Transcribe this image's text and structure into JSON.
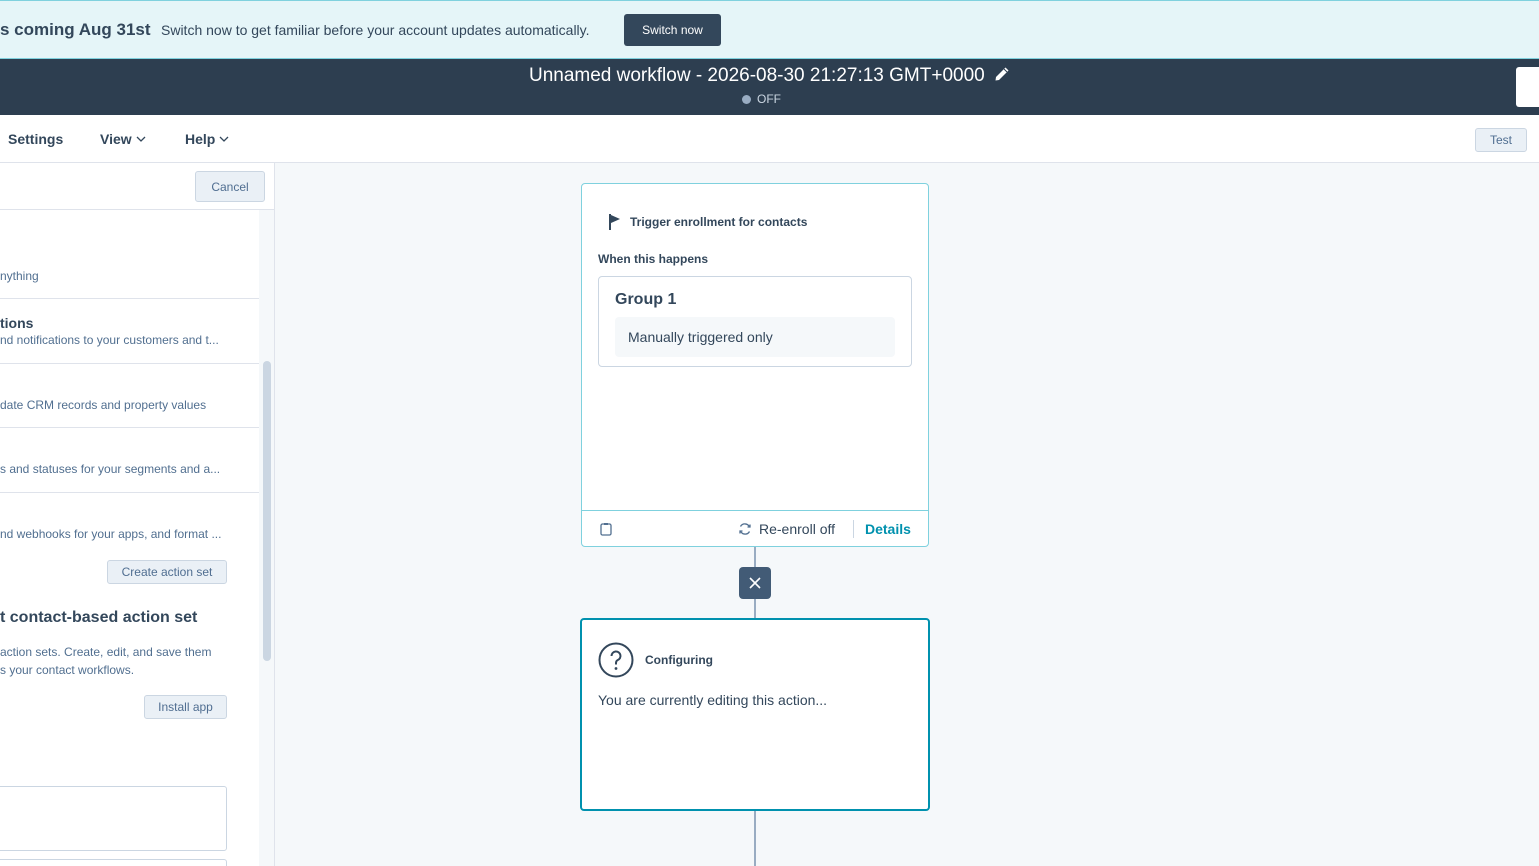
{
  "banner": {
    "title": "s coming Aug 31st",
    "text": "Switch now to get familiar before your account updates automatically.",
    "button": "Switch now"
  },
  "header": {
    "title": "Unnamed workflow - 2026-08-30 21:27:13 GMT+0000",
    "status": "OFF"
  },
  "menu": {
    "settings": "Settings",
    "view": "View",
    "help": "Help",
    "test": "Test"
  },
  "panel": {
    "cancel": "Cancel",
    "categories": [
      {
        "title": "",
        "desc": "nything"
      },
      {
        "title": "tions",
        "desc": "nd notifications to your customers and t..."
      },
      {
        "title": "",
        "desc": "date CRM records and property values"
      },
      {
        "title": "",
        "desc": "s and statuses for your segments and a..."
      },
      {
        "title": "",
        "desc": "nd webhooks for your apps, and format ..."
      }
    ],
    "create_action_set": "Create action set",
    "section_title": "t contact-based action set",
    "section_desc_1": "action sets. Create, edit, and save them",
    "section_desc_2": "s your contact workflows.",
    "install_app": "Install app"
  },
  "trigger": {
    "heading": "Trigger enrollment for contacts",
    "when": "When this happens",
    "group_title": "Group 1",
    "group_value": "Manually triggered only",
    "reenroll": "Re-enroll off",
    "details": "Details"
  },
  "config": {
    "heading": "Configuring",
    "text": "You are currently editing this action..."
  },
  "colors": {
    "header_bg": "#2d3e50",
    "accent": "#0091ae",
    "banner_bg": "#e5f5f8"
  }
}
